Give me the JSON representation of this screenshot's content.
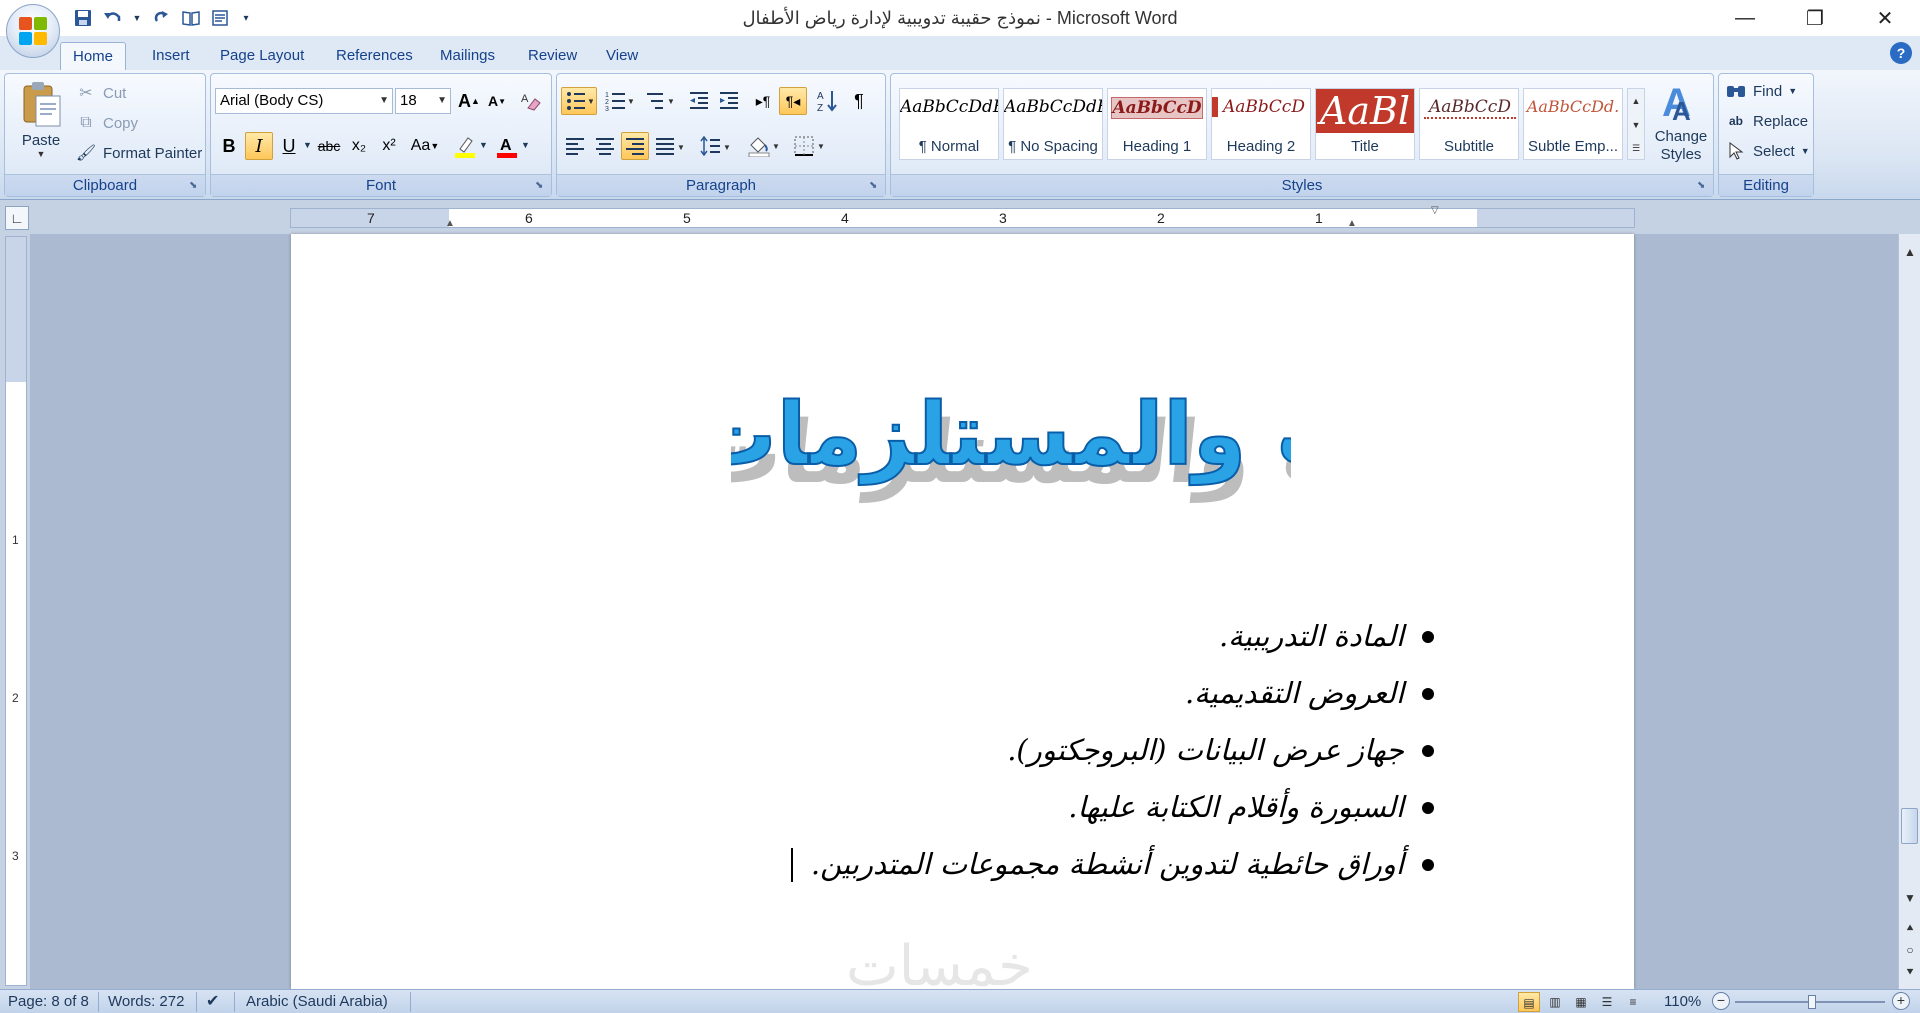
{
  "window": {
    "title": "نموذج حقيبة تدويبية لإدارة رياض الأطفال - Microsoft Word",
    "minimize": "—",
    "restore": "❐",
    "close": "✕"
  },
  "qat": {
    "save_icon": "save-icon",
    "undo_icon": "undo-icon",
    "redo_icon": "redo-icon"
  },
  "tabs": [
    "Home",
    "Insert",
    "Page Layout",
    "References",
    "Mailings",
    "Review",
    "View"
  ],
  "clipboard": {
    "group": "Clipboard",
    "paste": "Paste",
    "cut": "Cut",
    "copy": "Copy",
    "format_painter": "Format Painter"
  },
  "font": {
    "group": "Font",
    "name": "Arial (Body CS)",
    "size": "18",
    "bold": "B",
    "italic": "I",
    "underline": "U",
    "strike": "abc",
    "subscript": "x₂",
    "superscript": "x²",
    "case": "Aa",
    "grow": "A",
    "shrink": "A",
    "highlight_color": "#ffff00",
    "font_color": "#ff0000"
  },
  "paragraph": {
    "group": "Paragraph",
    "pilcrow": "¶"
  },
  "styles": {
    "group": "Styles",
    "change_styles": "Change Styles",
    "items": [
      {
        "preview": "AaBbCcDdE",
        "name": "¶ Normal"
      },
      {
        "preview": "AaBbCcDdE",
        "name": "¶ No Spacing"
      },
      {
        "preview": "AaBbCcD",
        "name": "Heading 1"
      },
      {
        "preview": "AaBbCcD",
        "name": "Heading 2"
      },
      {
        "preview": "AaBl",
        "name": "Title"
      },
      {
        "preview": "AaBbCcD",
        "name": "Subtitle"
      },
      {
        "preview": "AaBbCcDd.",
        "name": "Subtle Emp..."
      }
    ]
  },
  "editing": {
    "group": "Editing",
    "find": "Find",
    "replace": "Replace",
    "select": "Select"
  },
  "ruler": {
    "h_numbers": [
      "7",
      "6",
      "5",
      "4",
      "3",
      "2",
      "1"
    ],
    "v_numbers": [
      "1",
      "2",
      "3"
    ]
  },
  "document": {
    "wordart_title": "التجهيزات والمستلزمات التدريبية",
    "bullets": [
      "المادة التدريبية.",
      "العروض التقديمية.",
      "جهاز عرض البيانات (البروجكتور).",
      "السبورة وأقلام الكتابة عليها.",
      "أوراق حائطية لتدوين أنشطة مجموعات المتدربين."
    ],
    "watermark": "خمسات"
  },
  "status": {
    "page": "Page: 8 of 8",
    "words": "Words: 272",
    "language": "Arabic (Saudi Arabia)",
    "zoom": "110%"
  },
  "colors": {
    "accent": "#15428b",
    "wordart_fill": "#29a3e6",
    "wordart_stroke": "#0a5ea8"
  }
}
